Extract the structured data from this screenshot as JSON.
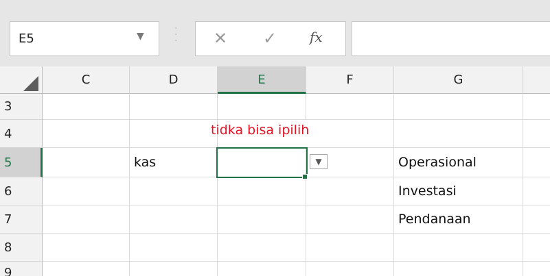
{
  "formula_bar": {
    "name_box": "E5",
    "name_box_dropdown_icon": "caret-down-icon",
    "cancel_icon": "close-icon",
    "enter_icon": "checkmark-icon",
    "fx_label": "fx",
    "formula_value": ""
  },
  "columns": [
    "C",
    "D",
    "E",
    "F",
    "G"
  ],
  "rows": [
    "3",
    "4",
    "5",
    "6",
    "7",
    "8",
    "9"
  ],
  "cells": {
    "D5": "kas",
    "G5": "Operasional",
    "G6": "Investasi",
    "G7": "Pendanaan"
  },
  "annotation": "tidka bisa ipilih",
  "colors": {
    "accent": "#217346",
    "annotation": "#e81123",
    "header_bg": "#f2f2f2",
    "selected_header_bg": "#d2d2d2"
  }
}
